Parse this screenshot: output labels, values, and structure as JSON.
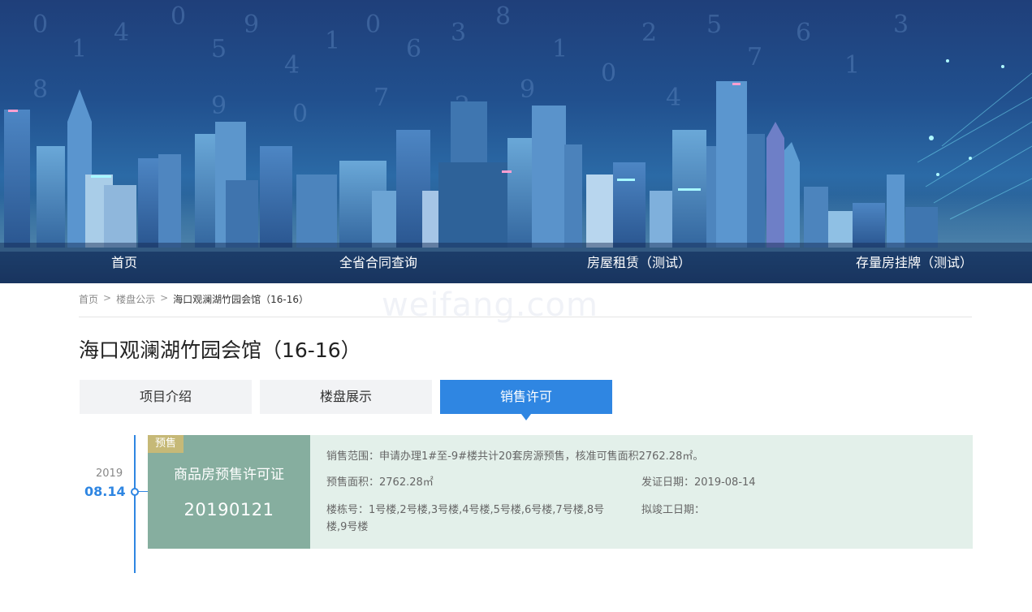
{
  "nav": {
    "items": [
      "首页",
      "全省合同查询",
      "房屋租赁（测试）",
      "存量房挂牌（测试）"
    ]
  },
  "breadcrumb": {
    "items": [
      "首页",
      "楼盘公示",
      "海口观澜湖竹园会馆（16-16）"
    ],
    "separator": ">"
  },
  "watermark": "weifang.com",
  "page_title": "海口观澜湖竹园会馆（16-16）",
  "tabs": [
    {
      "label": "项目介绍",
      "active": false
    },
    {
      "label": "楼盘展示",
      "active": false
    },
    {
      "label": "销售许可",
      "active": true
    }
  ],
  "timeline": {
    "year": "2019",
    "date": "08.14"
  },
  "permit": {
    "badge": "预售",
    "type": "商品房预售许可证",
    "number": "20190121",
    "scope_label": "销售范围：",
    "scope_value": "申请办理1#至-9#楼共计20套房源预售，核准可售面积2762.28㎡。",
    "area_label": "预售面积：",
    "area_value": "2762.28㎡",
    "issue_date_label": "发证日期：",
    "issue_date_value": "2019-08-14",
    "buildings_label": "楼栋号：",
    "buildings_value": "1号楼,2号楼,3号楼,4号楼,5号楼,6号楼,7号楼,8号楼,9号楼",
    "completion_label": "拟竣工日期：",
    "completion_value": ""
  },
  "colors": {
    "accent": "#2f86e2",
    "card_green": "#86ae9f",
    "card_bg": "#e3f0ea",
    "badge": "#c6b977"
  }
}
